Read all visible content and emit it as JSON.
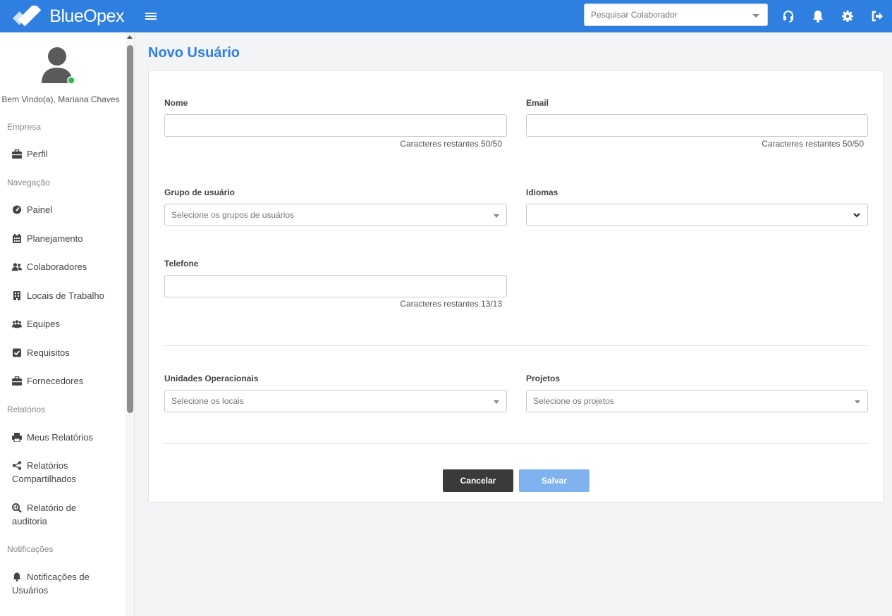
{
  "app": {
    "brand": "BlueOpex"
  },
  "header": {
    "search_placeholder": "Pesquisar Colaborador",
    "icons": [
      "headset-icon",
      "bell-icon",
      "gear-icon",
      "logout-icon"
    ]
  },
  "sidebar": {
    "welcome": "Bem Vindo(a), Mariana Chaves",
    "sections": {
      "empresa": "Empresa",
      "navegacao": "Navegação",
      "relatorios": "Relatórios",
      "notificacoes": "Notificações"
    },
    "items": {
      "perfil": "Perfil",
      "painel": "Painel",
      "planejamento": "Planejamento",
      "colaboradores": "Colaboradores",
      "locais": "Locais de Trabalho",
      "equipes": "Equipes",
      "requisitos": "Requisitos",
      "fornecedores": "Fornecedores",
      "meus_relatorios": "Meus Relatórios",
      "relatorios_compartilhados_1": "Relatórios",
      "relatorios_compartilhados_2": "Compartilhados",
      "relatorio_auditoria_1": "Relatório de",
      "relatorio_auditoria_2": "auditoria",
      "notificacoes_usuarios_1": "Notificações de",
      "notificacoes_usuarios_2": "Usuários"
    }
  },
  "page": {
    "title": "Novo Usuário"
  },
  "form": {
    "nome": {
      "label": "Nome",
      "value": "",
      "hint": "Caracteres restantes 50/50"
    },
    "email": {
      "label": "Email",
      "value": "",
      "hint": "Caracteres restantes 50/50"
    },
    "grupo": {
      "label": "Grupo de usuário",
      "placeholder": "Selecione os grupos de usuários"
    },
    "idiomas": {
      "label": "Idiomas",
      "value": ""
    },
    "telefone": {
      "label": "Telefone",
      "value": "",
      "hint": "Caracteres restantes 13/13"
    },
    "unidades": {
      "label": "Unidades Operacionais",
      "placeholder": "Selecione os locais"
    },
    "projetos": {
      "label": "Projetos",
      "placeholder": "Selecione os projetos"
    },
    "cancel_label": "Cancelar",
    "save_label": "Salvar"
  },
  "colors": {
    "accent": "#2f7fe0",
    "cancel_button": "#3a3a3a",
    "save_button": "#7fb2ee",
    "online_status": "#2bbb4d"
  }
}
